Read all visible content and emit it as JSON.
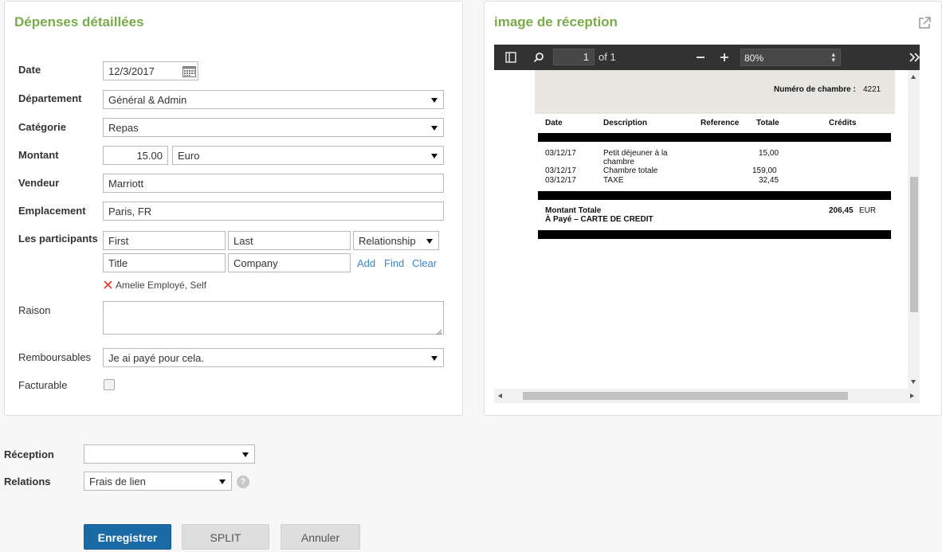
{
  "left_panel": {
    "title": "Dépenses détaillées",
    "date": {
      "label": "Date",
      "value": "12/3/2017"
    },
    "department": {
      "label": "Département",
      "value": "Général & Admin"
    },
    "category": {
      "label": "Catégorie",
      "value": "Repas"
    },
    "amount": {
      "label": "Montant",
      "value": "15.00",
      "currency": "Euro"
    },
    "vendor": {
      "label": "Vendeur",
      "value": "Marriott"
    },
    "location": {
      "label": "Emplacement",
      "value": "Paris, FR"
    },
    "participants": {
      "label": "Les participants",
      "first_placeholder": "First",
      "last_placeholder": "Last",
      "relationship": "Relationship",
      "title_placeholder": "Title",
      "company_placeholder": "Company",
      "add": "Add",
      "find": "Find",
      "clear": "Clear",
      "entries": [
        "Amelie Employé, Self"
      ]
    },
    "reason": {
      "label": "Raison",
      "value": ""
    },
    "reimbursable": {
      "label": "Remboursables",
      "value": "Je ai payé pour cela."
    },
    "billable": {
      "label": "Facturable",
      "checked": false
    }
  },
  "receipt_panel": {
    "title": "image de réception",
    "toolbar": {
      "page": "1",
      "of_pages": "of 1",
      "zoom": "80%"
    },
    "receipt": {
      "room_label": "Numéro de chambre :",
      "room_number": "4221",
      "columns": [
        "Date",
        "Description",
        "Reference",
        "Totale",
        "Crédits"
      ],
      "lines": [
        {
          "date": "03/12/17",
          "desc": "Petit déjeuner à la",
          "desc2": "chambre",
          "total": "15,00"
        },
        {
          "date": "03/12/17",
          "desc": "Chambre totale",
          "total": "159,00"
        },
        {
          "date": "03/12/17",
          "desc": "TAXE",
          "total": "32,45"
        }
      ],
      "total_label": "Montant Totale",
      "paid_label": "À Payé – CARTE DE CREDIT",
      "total_amount": "206,45",
      "total_currency": "EUR"
    }
  },
  "bottom": {
    "reception": {
      "label": "Réception",
      "value": ""
    },
    "relations": {
      "label": "Relations",
      "value": "Frais de lien"
    },
    "buttons": {
      "save": "Enregistrer",
      "split": "SPLIT",
      "cancel": "Annuler"
    }
  },
  "colors": {
    "accent_green": "#7aab4a",
    "primary_blue": "#1a6aa6",
    "link_blue": "#3b86c4",
    "remove_red": "#e0453a"
  }
}
